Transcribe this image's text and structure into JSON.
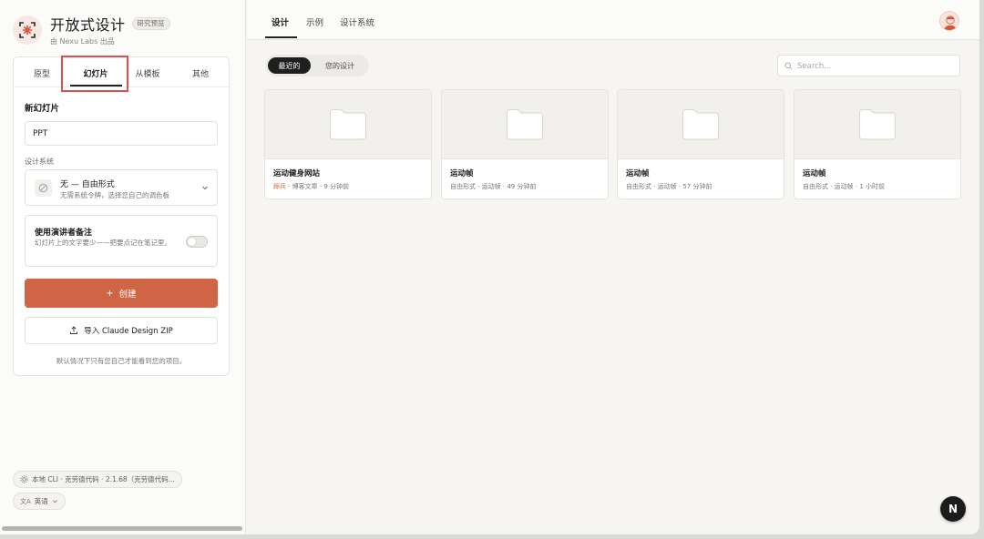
{
  "brand": {
    "title": "开放式设计",
    "badge": "研究预览",
    "subtitle": "由 Nexu Labs 出品",
    "logo_icon": "frame-spark-icon",
    "accent_color": "#cf6544"
  },
  "sidebar": {
    "tabs": [
      {
        "label": "原型"
      },
      {
        "label": "幻灯片",
        "active": true
      },
      {
        "label": "从模板"
      },
      {
        "label": "其他"
      }
    ],
    "section_title": "新幻灯片",
    "name_input": {
      "value": "PPT"
    },
    "design_system_label": "设计系统",
    "design_system": {
      "title": "无 — 自由形式",
      "description": "无需系统令牌，选择您自己的调色板"
    },
    "speaker_notes": {
      "title": "使用演讲者备注",
      "description": "幻灯片上的文字要少——把要点记在笔记里。",
      "enabled": false
    },
    "create_label": "创建",
    "import_label": "导入 Claude Design ZIP",
    "visibility_note": "默认情况下只有您自己才能看到您的项目。",
    "env_chip": "本地 CLI · 克劳德代码 · 2.1.68（克劳德代码...",
    "lang_chip": "英语"
  },
  "main": {
    "tabs": [
      {
        "label": "设计",
        "active": true
      },
      {
        "label": "示例"
      },
      {
        "label": "设计系统"
      }
    ],
    "filters": [
      {
        "label": "最近的",
        "active": true
      },
      {
        "label": "您的设计"
      }
    ],
    "search": {
      "placeholder": "Search...",
      "value": ""
    },
    "cards": [
      {
        "title": "运动健身网站",
        "tag": "蹄兵",
        "meta": " · 博客文章 · 9 分钟前"
      },
      {
        "title": "运动帧",
        "meta": "自由形式 · 运动帧 · 49 分钟前"
      },
      {
        "title": "运动帧",
        "meta": "自由形式 · 运动帧 · 57 分钟前"
      },
      {
        "title": "运动帧",
        "meta": "自由形式 · 运动帧 · 1 小时前"
      }
    ]
  },
  "fab": {
    "label": "N"
  }
}
